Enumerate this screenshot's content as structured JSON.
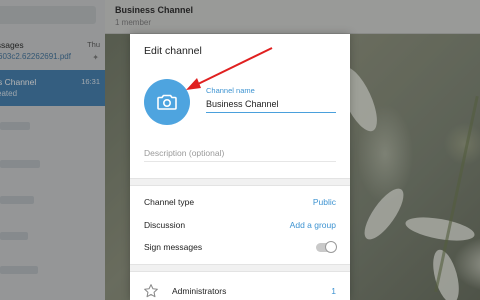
{
  "sidebar": {
    "section_title": "essages",
    "section_time": "Thu",
    "file_item": "603c2.62262691.pdf",
    "active_chat": {
      "title": "s Channel",
      "time": "16:31",
      "subtitle": "eated"
    }
  },
  "header": {
    "title": "Business Channel",
    "subtitle": "1 member"
  },
  "dialog": {
    "title": "Edit channel",
    "photo_icon": "camera-icon",
    "name_label": "Channel name",
    "name_value": "Business Channel",
    "description_placeholder": "Description (optional)",
    "options": [
      {
        "label": "Channel type",
        "value": "Public"
      },
      {
        "label": "Discussion",
        "value": "Add a group"
      },
      {
        "label": "Sign messages",
        "value": ""
      }
    ],
    "sign_messages_enabled": false,
    "admin": {
      "icon": "star-icon",
      "label": "Administrators",
      "count": "1"
    }
  },
  "colors": {
    "accent": "#4ea4df",
    "link": "#3d93d1",
    "annotation_arrow": "#e02020",
    "active_chat_bg": "#3b7bb0"
  }
}
